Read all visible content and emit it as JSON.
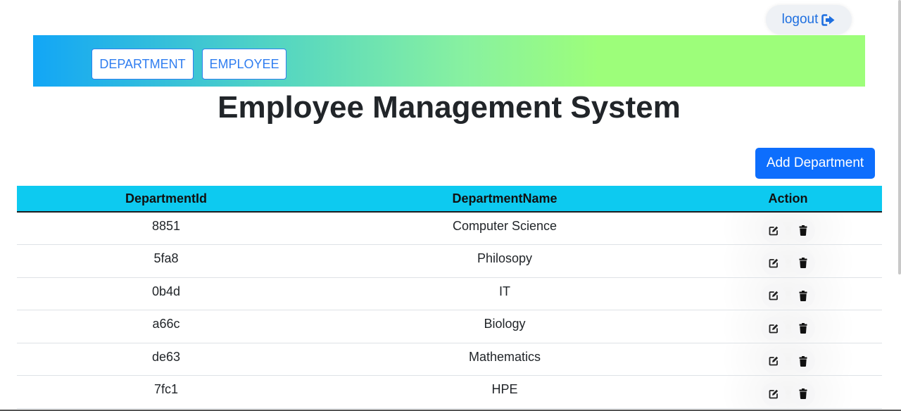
{
  "header": {
    "logout_label": "logout",
    "logout_icon": "sign-out-icon"
  },
  "nav": {
    "department_label": "DEPARTMENT",
    "employee_label": "EMPLOYEE"
  },
  "page": {
    "title": "Employee Management System",
    "add_button_label": "Add Department"
  },
  "table": {
    "columns": [
      "DepartmentId",
      "DepartmentName",
      "Action"
    ],
    "rows": [
      {
        "id": "8851",
        "name": "Computer Science"
      },
      {
        "id": "5fa8",
        "name": "Philosopy"
      },
      {
        "id": "0b4d",
        "name": "IT"
      },
      {
        "id": "a66c",
        "name": "Biology"
      },
      {
        "id": "de63",
        "name": "Mathematics"
      },
      {
        "id": "7fc1",
        "name": "HPE"
      }
    ],
    "row_actions": [
      "edit-icon",
      "trash-icon"
    ]
  },
  "colors": {
    "primary": "#0d6efd",
    "table_header": "#0dcaf0",
    "nav_gradient_start": "#12a6f6",
    "nav_gradient_end": "#9dfe7a",
    "link_blue": "#1e6fe0"
  }
}
